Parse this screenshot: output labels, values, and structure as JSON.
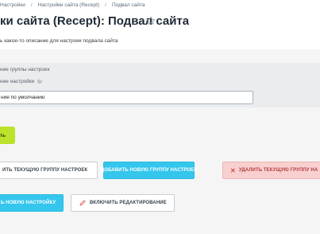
{
  "breadcrumb": {
    "items": [
      "Настройки",
      "Настройки сайта (Recept)",
      "Подвал сайта"
    ],
    "separator": "/"
  },
  "page": {
    "title": "ки сайта (Recept): Подвал сайта",
    "description": "ь какое-то описание для настроек подвала сайта"
  },
  "form": {
    "group_name_label": "ние группы настроек",
    "setting_name_label": "ние настройки",
    "value_field": "ние по умолчанию",
    "save_label": "ть"
  },
  "actions": {
    "save_group_label": "ИТЬ ТЕКУЩУЮ ГРУППУ НАСТРОЕК",
    "add_group_label": "ДОБАВИТЬ НОВУЮ ГРУППУ НАСТРОЕК",
    "delete_group_label": "УДАЛИТЬ ТЕКУЩУЮ ГРУППУ НА",
    "add_setting_label": "Ь НОВУЮ НАСТРОЙКУ",
    "enable_edit_label": "ВКЛЮЧИТЬ РЕДАКТИРОВАНИЕ"
  },
  "icons": {
    "favorite": "star-icon",
    "help": "help-icon",
    "delete": "close-icon",
    "edit": "pencil-icon"
  },
  "colors": {
    "accent_green": "#bde22a",
    "accent_blue": "#34c6ec",
    "danger_bg": "#f9d0d0",
    "danger_text": "#b33c3c"
  }
}
